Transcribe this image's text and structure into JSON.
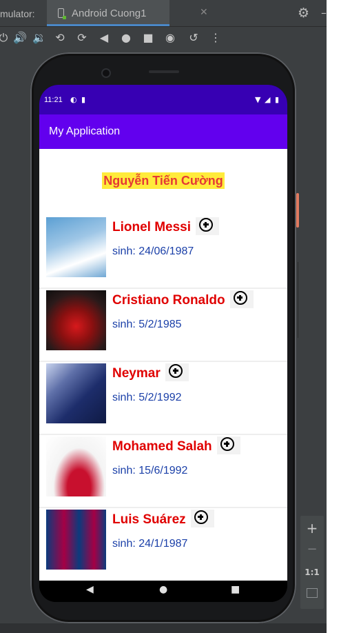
{
  "ide": {
    "emulator_label": "mulator:",
    "tab_label": "Android Cuong1",
    "tab_close": "✕",
    "settings_icon": "gear-icon",
    "toolbar_icons": [
      "power-icon",
      "volume-up-icon",
      "volume-down-icon",
      "rotate-left-icon",
      "rotate-right-icon",
      "back-icon",
      "home-icon",
      "overview-icon",
      "screenshot-icon",
      "snapshot-icon",
      "more-icon"
    ],
    "zoom_in": "+",
    "zoom_out": "−",
    "zoom_actual": "1:1"
  },
  "device": {
    "status_time": "11:21",
    "app_title": "My Application"
  },
  "main": {
    "heading": "Nguyễn Tiến Cường",
    "players": [
      {
        "name": "Lionel Messi",
        "dob": "sinh: 24/06/1987",
        "colors": [
          "#9ec6e6",
          "#ffffff"
        ]
      },
      {
        "name": "Cristiano Ronaldo",
        "dob": "sinh: 5/2/1985",
        "colors": [
          "#2a1a1a",
          "#d7191c"
        ]
      },
      {
        "name": "Neymar",
        "dob": "sinh: 5/2/1992",
        "colors": [
          "#1d2d6b",
          "#c9d4ee"
        ]
      },
      {
        "name": "Mohamed Salah",
        "dob": "sinh: 15/6/1992",
        "colors": [
          "#f4f4f4",
          "#c8102e"
        ]
      },
      {
        "name": "Luis Suárez",
        "dob": "sinh: 24/1/1987",
        "colors": [
          "#0b3b7d",
          "#a50044"
        ]
      }
    ]
  },
  "colors": {
    "status_bar": "#3700b3",
    "app_bar": "#6200ee",
    "heading_bg": "#ffeb3b",
    "heading_text": "#e53935",
    "name_text": "#e00000",
    "dob_text": "#1a3fa8"
  }
}
